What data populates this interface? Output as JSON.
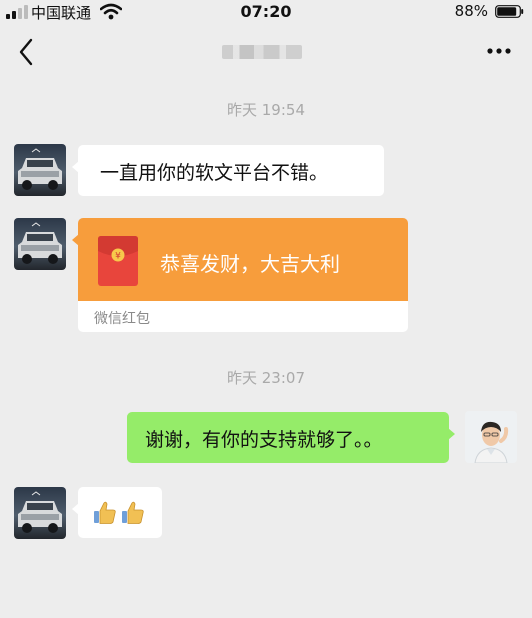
{
  "status_bar": {
    "carrier": "中国联通",
    "time": "07:20",
    "battery": "88%",
    "battery_level": 0.88
  },
  "nav": {
    "title": "",
    "back_icon": "chevron-left-icon",
    "more_icon": "ellipsis-icon"
  },
  "messages": {
    "timestamp_1": "昨天 19:54",
    "msg_1": "一直用你的软文平台不错。",
    "red_packet_text": "恭喜发财，大吉大利",
    "red_packet_label": "微信红包",
    "timestamp_2": "昨天 23:07",
    "msg_2": "谢谢，有你的支持就够了。。",
    "msg_3_icons": [
      "thumbs-up-icon",
      "thumbs-up-icon"
    ]
  },
  "colors": {
    "background": "#ededed",
    "sent_bubble": "#95ec69",
    "received_bubble": "#ffffff",
    "red_packet": "#f79d3c",
    "timestamp": "#a9a9a9"
  }
}
